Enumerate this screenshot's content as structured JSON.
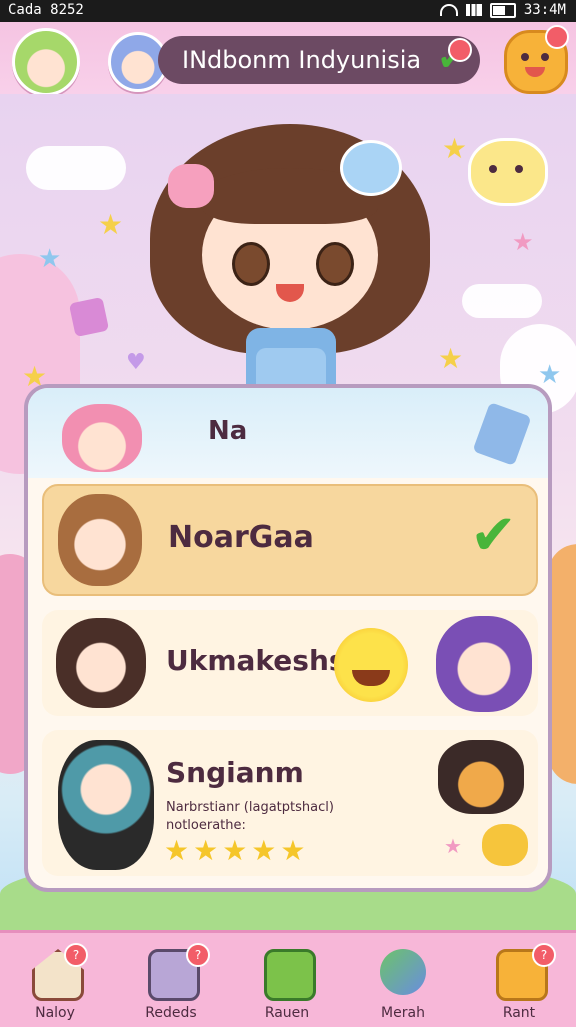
{
  "status_bar": {
    "left_text": "Cada 8252",
    "right_text": "33:4M"
  },
  "header": {
    "title": "INdbonm Indyunisia"
  },
  "panel": {
    "top_label": "Na",
    "rows": [
      {
        "name": "NoarGaa"
      },
      {
        "name": "Ukmakeshs"
      },
      {
        "name": "Sngianm",
        "desc_line1": "Narbrstianr (lagatptshacl)",
        "desc_line2": "notloerathe:",
        "stars": 5
      }
    ]
  },
  "nav": {
    "items": [
      {
        "label": "Naloy",
        "badge": "?"
      },
      {
        "label": "Rededs",
        "badge": "?"
      },
      {
        "label": "Rauen",
        "badge": ""
      },
      {
        "label": "Merah",
        "badge": ""
      },
      {
        "label": "Rant",
        "badge": "?"
      }
    ]
  },
  "colors": {
    "header_bg": "#f5c4e2",
    "pill": "#6c4a63",
    "selected_row": "#f7d79e",
    "nav_bg": "#f7b7d8",
    "check": "#49b53a"
  }
}
